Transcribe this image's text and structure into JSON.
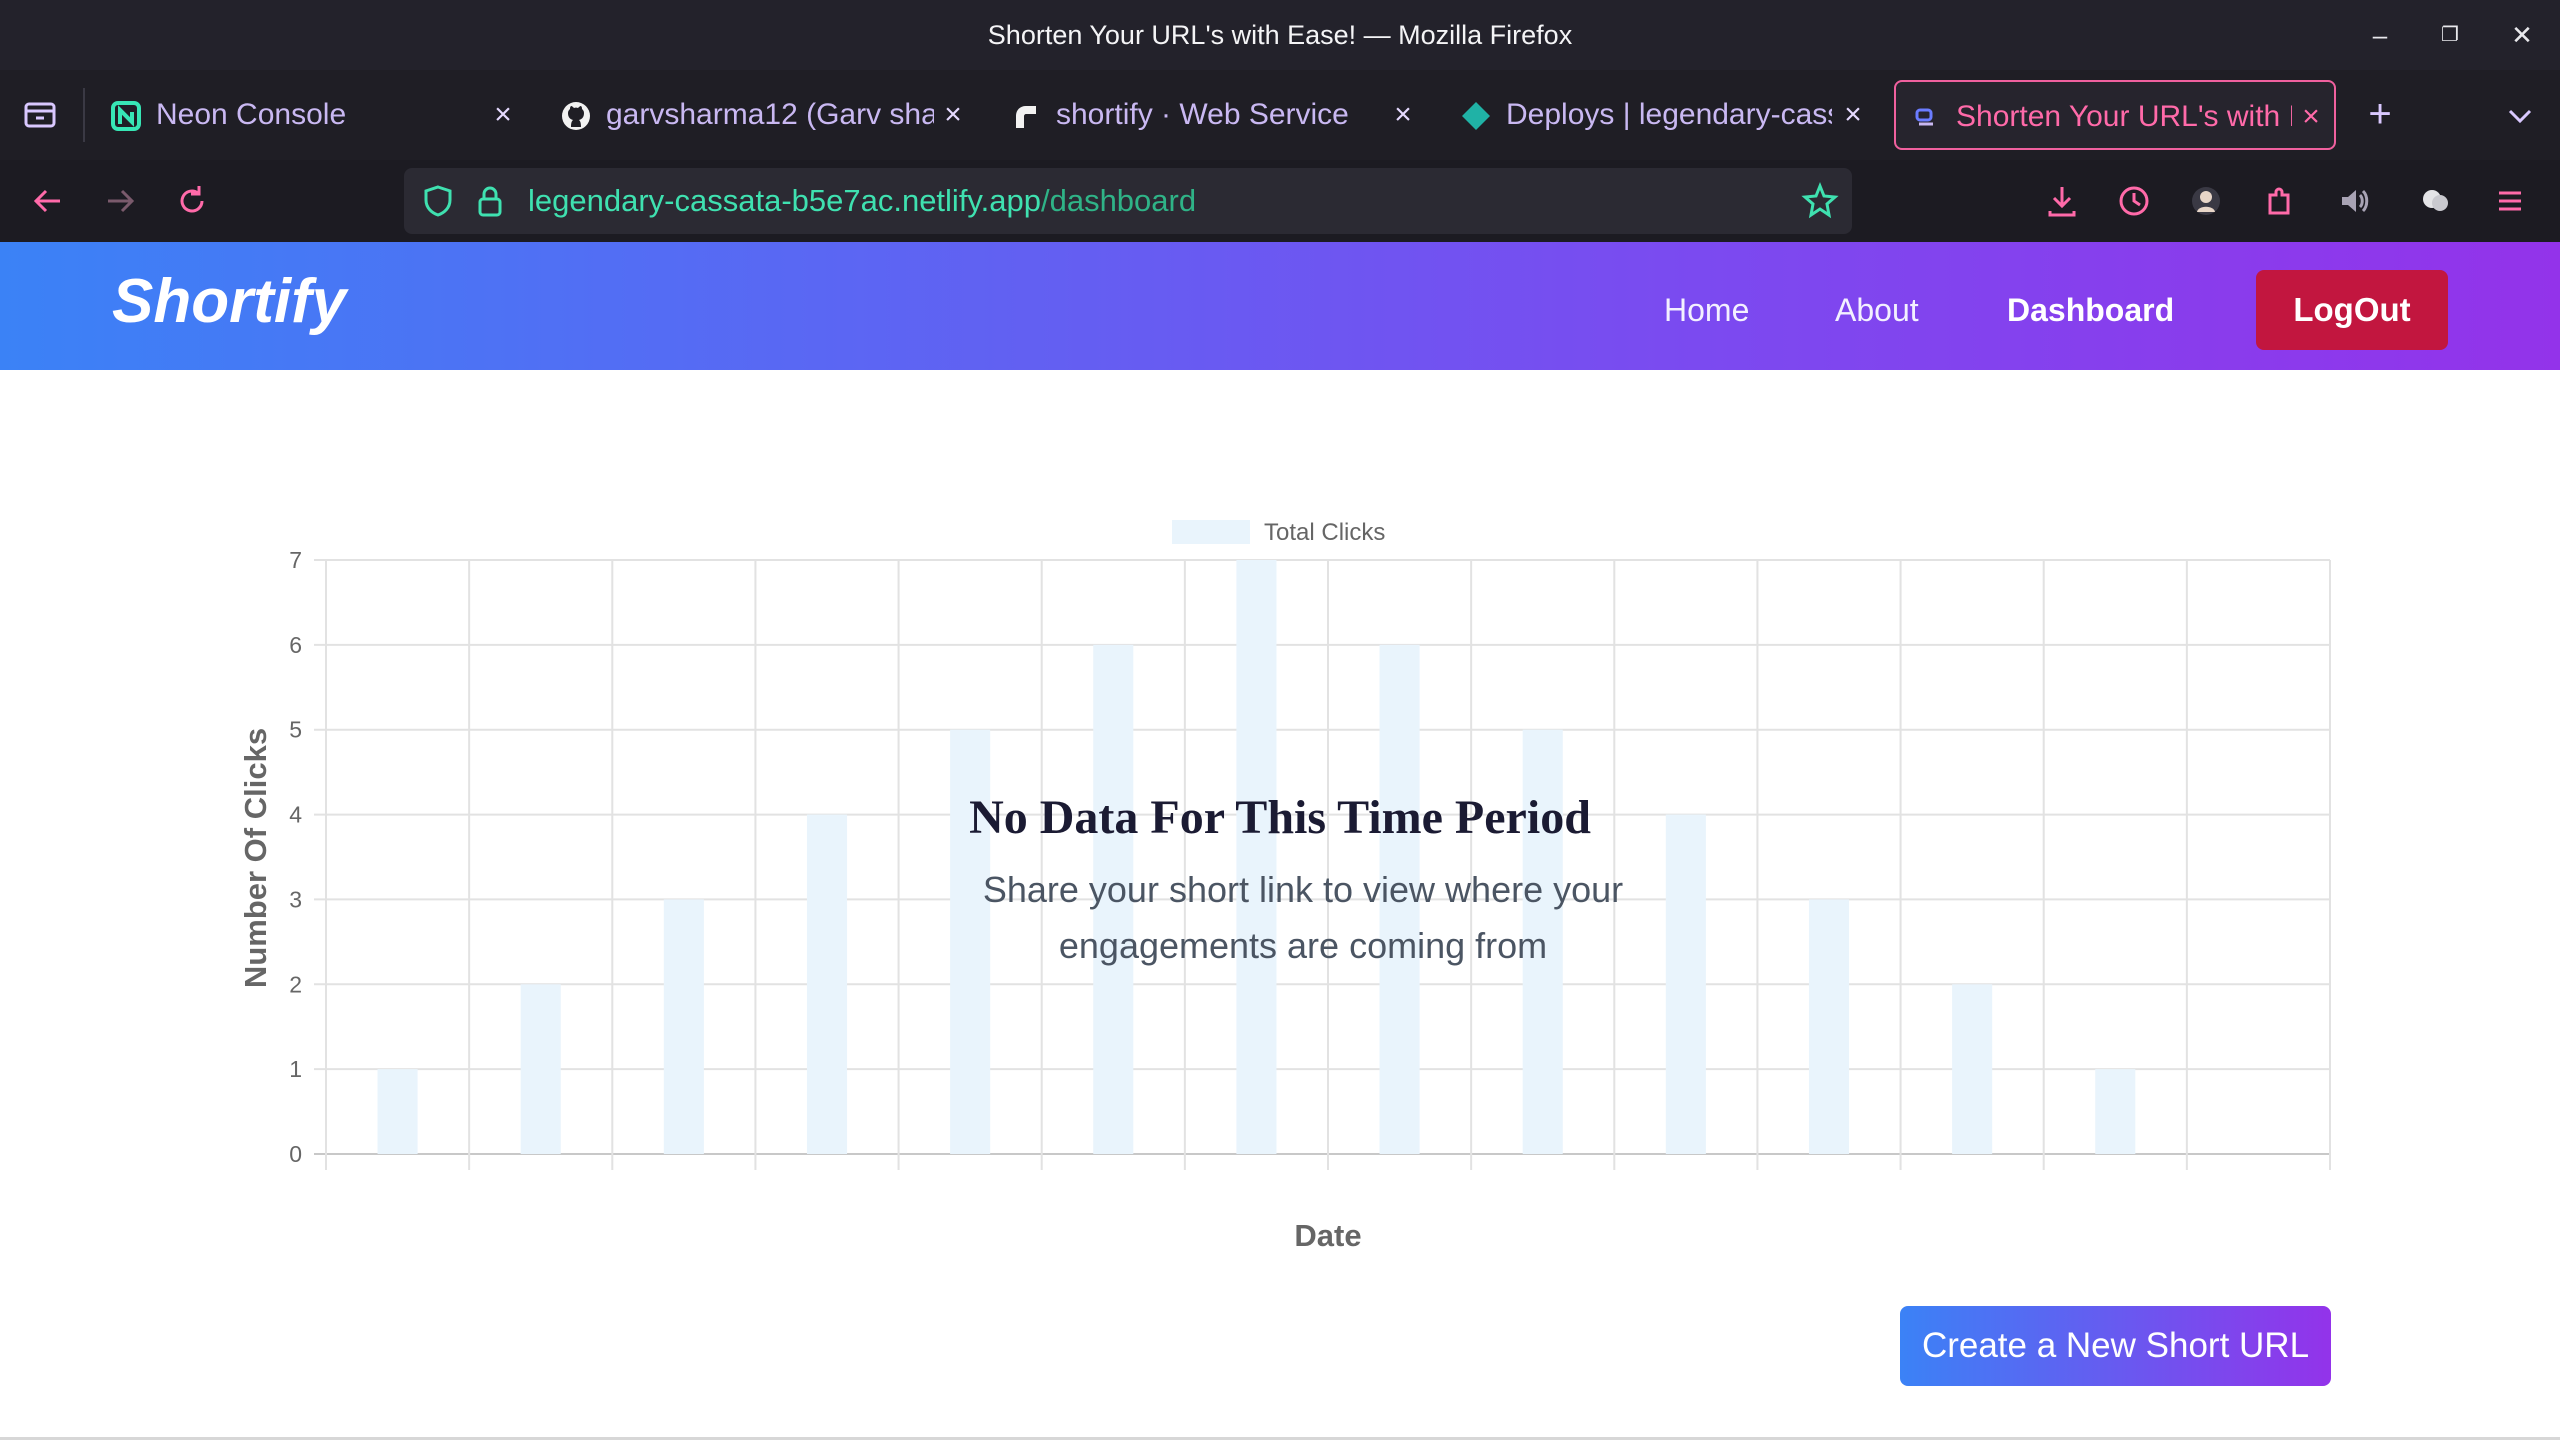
{
  "window": {
    "title": "Shorten Your URL's with Ease! — Mozilla Firefox"
  },
  "tabs": [
    {
      "label": "Neon Console",
      "icon": "neon-icon",
      "active": false
    },
    {
      "label": "garvsharma12 (Garv sharma)",
      "icon": "github-icon",
      "active": false
    },
    {
      "label": "shortify · Web Service",
      "icon": "render-icon",
      "active": false
    },
    {
      "label": "Deploys | legendary-cassata",
      "icon": "netlify-icon",
      "active": false
    },
    {
      "label": "Shorten Your URL's with Ease!",
      "icon": "shortify-icon",
      "active": true
    }
  ],
  "address_bar": {
    "host": "legendary-cassata-b5e7ac.netlify.app",
    "path": "/dashboard"
  },
  "site": {
    "logo": "Shortify",
    "nav": {
      "home": "Home",
      "about": "About",
      "dashboard": "Dashboard"
    },
    "logout": "LogOut"
  },
  "chart_data": {
    "type": "bar",
    "legend": "Total Clicks",
    "legend_position": "top-center",
    "ylabel": "Number Of Clicks",
    "xlabel": "Date",
    "ylim": [
      0,
      7
    ],
    "yticks": [
      0,
      1,
      2,
      3,
      4,
      5,
      6,
      7
    ],
    "grid": true,
    "values": [
      1,
      2,
      3,
      4,
      5,
      6,
      7,
      6,
      5,
      4,
      3,
      2,
      1
    ],
    "bar_color": "#e9f4fc"
  },
  "empty_state": {
    "title": "No Data For This Time Period",
    "message": "Share your short link to view where your engagements are coming from"
  },
  "actions": {
    "create": "Create a New Short URL"
  },
  "colors": {
    "accent_pink": "#ff6aa9",
    "logout_red": "#c2163f",
    "gradient_start": "#3b82f6",
    "gradient_end": "#9333ea"
  }
}
